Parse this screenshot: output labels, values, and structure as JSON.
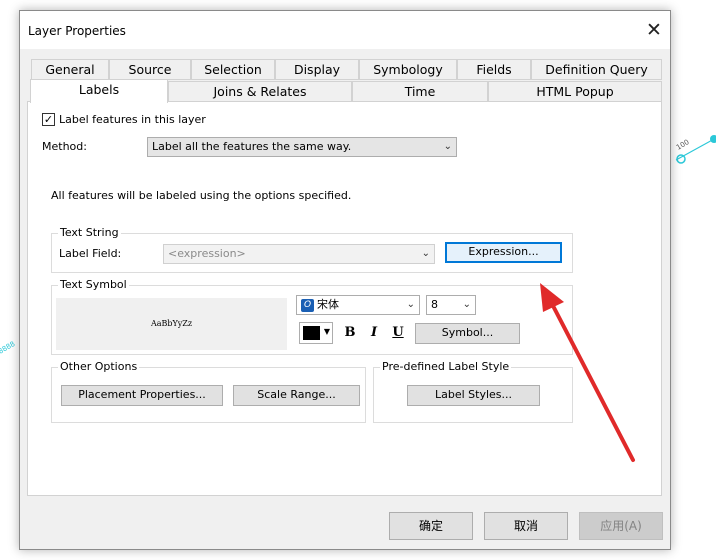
{
  "window": {
    "title": "Layer Properties",
    "close_glyph": "✕"
  },
  "tabs_row1": [
    "General",
    "Source",
    "Selection",
    "Display",
    "Symbology",
    "Fields",
    "Definition Query"
  ],
  "tabs_row2": [
    "Labels",
    "Joins & Relates",
    "Time",
    "HTML Popup"
  ],
  "active_tab": "Labels",
  "label_checkbox": {
    "label": "Label features in this layer",
    "checked": true,
    "check_glyph": "✓"
  },
  "method": {
    "label": "Method:",
    "value": "Label all the features the same way."
  },
  "info_text": "All features will be labeled using the options specified.",
  "text_string": {
    "group_label": "Text String",
    "field_label": "Label Field:",
    "field_placeholder": "<expression>",
    "expression_button": "Expression..."
  },
  "text_symbol": {
    "group_label": "Text Symbol",
    "preview_text": "AaBbYyZz",
    "font_icon_glyph": "O",
    "font_name": "宋体",
    "font_size": "8",
    "color": "#000000",
    "bold": "B",
    "italic": "I",
    "underline": "U",
    "symbol_button": "Symbol..."
  },
  "other_options": {
    "group_label": "Other Options",
    "placement_button": "Placement Properties...",
    "scale_button": "Scale Range..."
  },
  "predefined_style": {
    "group_label": "Pre-defined Label Style",
    "label_styles_button": "Label Styles..."
  },
  "footer": {
    "ok": "确定",
    "cancel": "取消",
    "apply": "应用(A)"
  },
  "background_text": {
    "map_label": "100",
    "left_marks": "8888"
  },
  "colors": {
    "annotation_arrow": "#e02a2a",
    "map_feature": "#2bc8d8",
    "focus_border": "#0078d7"
  }
}
